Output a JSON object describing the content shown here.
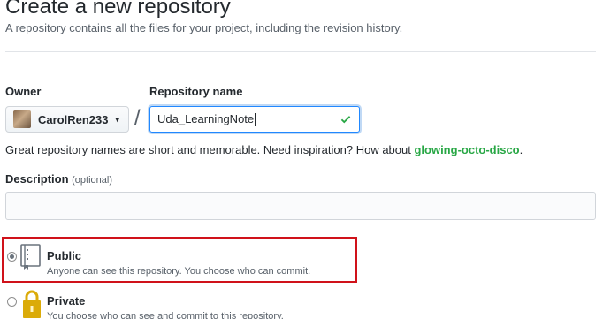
{
  "header": {
    "title": "Create a new repository",
    "subtitle": "A repository contains all the files for your project, including the revision history."
  },
  "form": {
    "owner_label": "Owner",
    "owner_value": "CarolRen233",
    "separator": "/",
    "repo_name_label": "Repository name",
    "repo_name_value": "Uda_LearningNote",
    "hint_prefix": "Great repository names are short and memorable. Need inspiration? How about ",
    "hint_suggestion": "glowing-octo-disco",
    "hint_suffix": ".",
    "description_label": "Description",
    "description_optional": "(optional)",
    "description_value": ""
  },
  "visibility": {
    "selected": "public",
    "options": [
      {
        "title": "Public",
        "description": "Anyone can see this repository. You choose who can commit."
      },
      {
        "title": "Private",
        "description": "You choose who can see and commit to this repository."
      }
    ]
  },
  "colors": {
    "accent_blue": "#2188ff",
    "success_green": "#28a745",
    "highlight_red": "#d0121a",
    "lock_gold": "#dbab09"
  },
  "icons": {
    "public": "repo-icon",
    "private": "lock-icon",
    "valid": "check-icon"
  }
}
